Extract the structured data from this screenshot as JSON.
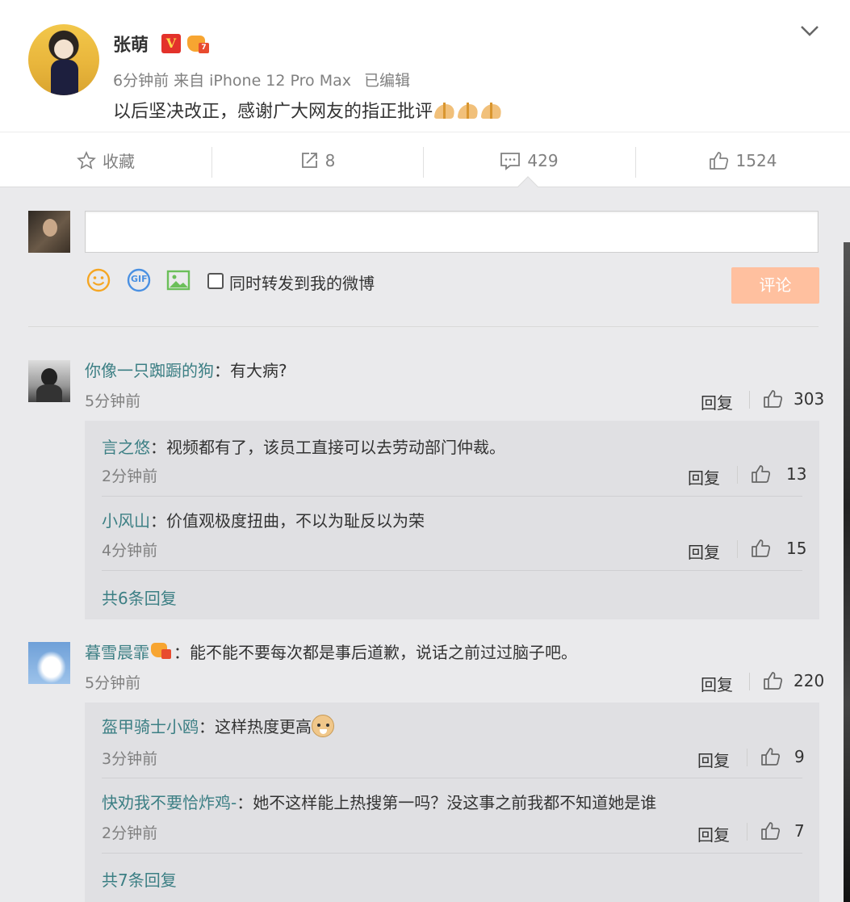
{
  "post": {
    "author": "张萌",
    "verified_badge": "V",
    "member_level": "7",
    "time": "6分钟前",
    "source": "来自 iPhone 12 Pro Max",
    "edited": "已编辑",
    "text": "以后坚决改正，感谢广大网友的指正批评"
  },
  "actions": {
    "favorite_label": "收藏",
    "repost_count": "8",
    "comment_count": "429",
    "like_count": "1524"
  },
  "composer": {
    "input_value": "",
    "repost_label": "同时转发到我的微博",
    "submit_label": "评论",
    "gif_label": "GIF"
  },
  "comments": [
    {
      "name": "你像一只踟蹰的狗",
      "text": "：有大病?",
      "time": "5分钟前",
      "reply_label": "回复",
      "likes": "303",
      "replies": [
        {
          "name": "言之悠",
          "text": "：视频都有了，该员工直接可以去劳动部门仲裁。",
          "time": "2分钟前",
          "reply_label": "回复",
          "likes": "13"
        },
        {
          "name": "小风山",
          "text": "：价值观极度扭曲，不以为耻反以为荣",
          "time": "4分钟前",
          "reply_label": "回复",
          "likes": "15"
        }
      ],
      "more": "共6条回复"
    },
    {
      "name": "暮雪晨霏",
      "text": "：能不能不要每次都是事后道歉，说话之前过过脑子吧。",
      "time": "5分钟前",
      "reply_label": "回复",
      "likes": "220",
      "replies": [
        {
          "name": "盔甲骑士小鸥",
          "text": "：这样热度更高",
          "time": "3分钟前",
          "reply_label": "回复",
          "likes": "9"
        },
        {
          "name": "快劝我不要恰炸鸡-",
          "text": "：她不这样能上热搜第一吗？没这事之前我都不知道她是谁",
          "time": "2分钟前",
          "reply_label": "回复",
          "likes": "7"
        }
      ],
      "more": "共7条回复"
    }
  ],
  "colors": {
    "link": "#3c7f84",
    "submit_disabled": "#ffc09f",
    "emoji": "#f5a623",
    "gif": "#4a90e2",
    "image": "#6bbf59"
  }
}
